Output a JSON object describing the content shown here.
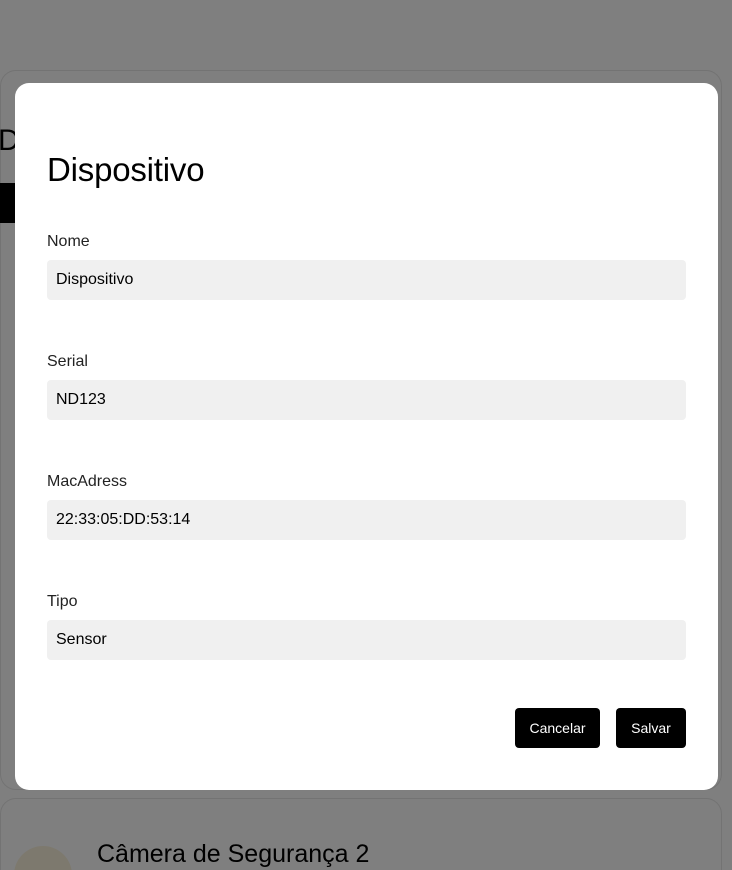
{
  "background": {
    "page_title_fragment": "D",
    "device_card_name": "Câmera de Segurança 2"
  },
  "modal": {
    "title": "Dispositivo",
    "fields": [
      {
        "label": "Nome",
        "value": "Dispositivo"
      },
      {
        "label": "Serial",
        "value": "ND123"
      },
      {
        "label": "MacAdress",
        "value": "22:33:05:DD:53:14"
      },
      {
        "label": "Tipo",
        "value": "Sensor"
      }
    ],
    "cancel_label": "Cancelar",
    "save_label": "Salvar"
  },
  "colors": {
    "overlay": "#808080",
    "input_background": "#f0f0f0",
    "button_background": "#000000",
    "button_text": "#ffffff"
  }
}
